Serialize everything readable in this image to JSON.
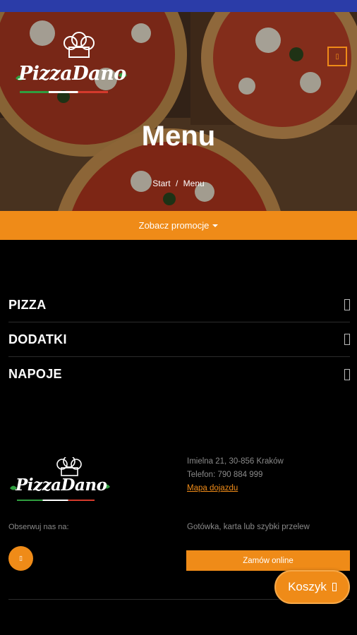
{
  "brand": {
    "logo_text": "PizzaDano",
    "colors": {
      "accent": "#ef8b18",
      "statusbar": "#2b3ca8",
      "background": "#000000"
    }
  },
  "header": {
    "menu_toggle_icon": "menu-icon",
    "title": "Menu",
    "breadcrumb": {
      "home": "Start",
      "separator": "/",
      "current": "Menu"
    }
  },
  "promo": {
    "label": "Zobacz promocje",
    "icon": "caret-down-icon"
  },
  "categories": [
    {
      "label": "PIZZA",
      "icon": "expand-icon"
    },
    {
      "label": "DODATKI",
      "icon": "expand-icon"
    },
    {
      "label": "NAPOJE",
      "icon": "expand-icon"
    }
  ],
  "footer": {
    "follow_label": "Obserwuj nas na:",
    "social_icon": "facebook-icon",
    "address": "Imielna 21, 30-856 Kraków",
    "phone": "Telefon: 790 884 999",
    "map_link": "Mapa dojazdu",
    "payment": "Gotówka, karta lub szybki przelew",
    "order_button": "Zamów online"
  },
  "cart": {
    "label": "Koszyk",
    "icon": "cart-icon"
  }
}
